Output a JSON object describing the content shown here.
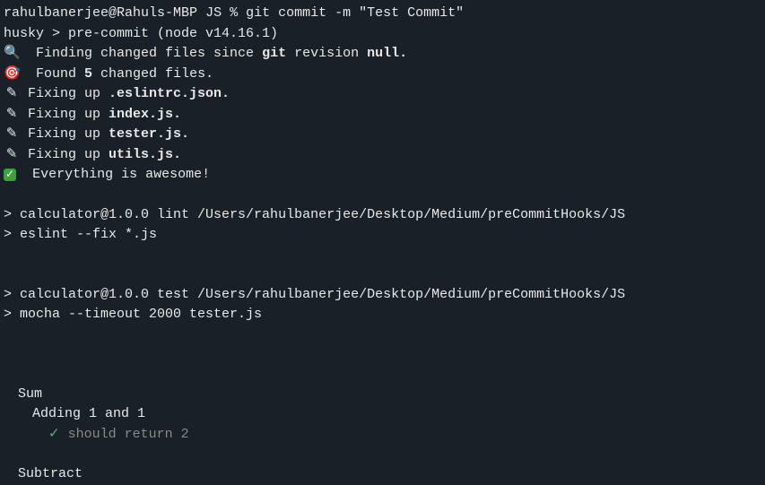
{
  "prompt": {
    "user_host": "rahulbanerjee@Rahuls-MBP",
    "cwd": "JS",
    "symbol": "%",
    "command": "git commit -m \"Test Commit\""
  },
  "husky": {
    "prefix": "husky > pre-commit (node v14.16.1)"
  },
  "lines": {
    "finding_prefix": "Finding changed files since ",
    "finding_bold1": "git",
    "finding_mid": " revision ",
    "finding_bold2": "null.",
    "found_prefix": "Found ",
    "found_count": "5",
    "found_suffix": " changed files.",
    "fixing_prefix": "Fixing up ",
    "file1": ".eslintrc.json.",
    "file2": "index.js.",
    "file3": "tester.js.",
    "file4": "utils.js.",
    "everything": "Everything is awesome!"
  },
  "npm": {
    "line1_prefix": "> ",
    "line1": "calculator@1.0.0 lint /Users/rahulbanerjee/Desktop/Medium/preCommitHooks/JS",
    "line2_prefix": "> ",
    "line2": "eslint --fix *.js",
    "line3_prefix": "> ",
    "line3": "calculator@1.0.0 test /Users/rahulbanerjee/Desktop/Medium/preCommitHooks/JS",
    "line4_prefix": "> ",
    "line4": "mocha --timeout 2000 tester.js"
  },
  "mocha": {
    "suite1": "Sum",
    "context1": "Adding 1 and 1",
    "check": "✓",
    "test1": " should return 2",
    "suite2": "Subtract"
  },
  "icons": {
    "magnifier": "🔍",
    "target": "🎯",
    "pencil": "✎",
    "checkbox": "✓"
  }
}
